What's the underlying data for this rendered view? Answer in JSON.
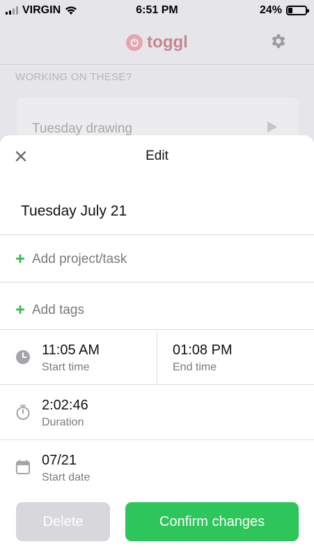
{
  "status_bar": {
    "carrier": "VIRGIN",
    "time": "6:51 PM",
    "battery": "24%",
    "battery_level": 0.24,
    "signal_bars": 2
  },
  "background": {
    "brand": "toggl",
    "section_title": "WORKING ON THESE?",
    "suggestion": "Tuesday drawing"
  },
  "edit_sheet": {
    "title": "Edit",
    "date_heading": "Tuesday July 21",
    "add_project_label": "Add project/task",
    "add_tags_label": "Add tags",
    "start_time": {
      "value": "11:05 AM",
      "label": "Start time"
    },
    "end_time": {
      "value": "01:08 PM",
      "label": "End time"
    },
    "duration": {
      "value": "2:02:46",
      "label": "Duration"
    },
    "start_date": {
      "value": "07/21",
      "label": "Start date"
    },
    "delete_label": "Delete",
    "confirm_label": "Confirm changes"
  },
  "colors": {
    "accent_green": "#2ec55a",
    "plus_green": "#2dbc4a",
    "delete_gray": "#d7d7dc",
    "toggl_pink": "#e3a6ad"
  },
  "icons": [
    "close-icon",
    "plus-icon",
    "clock-icon",
    "stopwatch-icon",
    "calendar-icon",
    "gear-icon",
    "wifi-icon",
    "battery-icon",
    "signal-icon",
    "play-icon",
    "power-icon"
  ]
}
